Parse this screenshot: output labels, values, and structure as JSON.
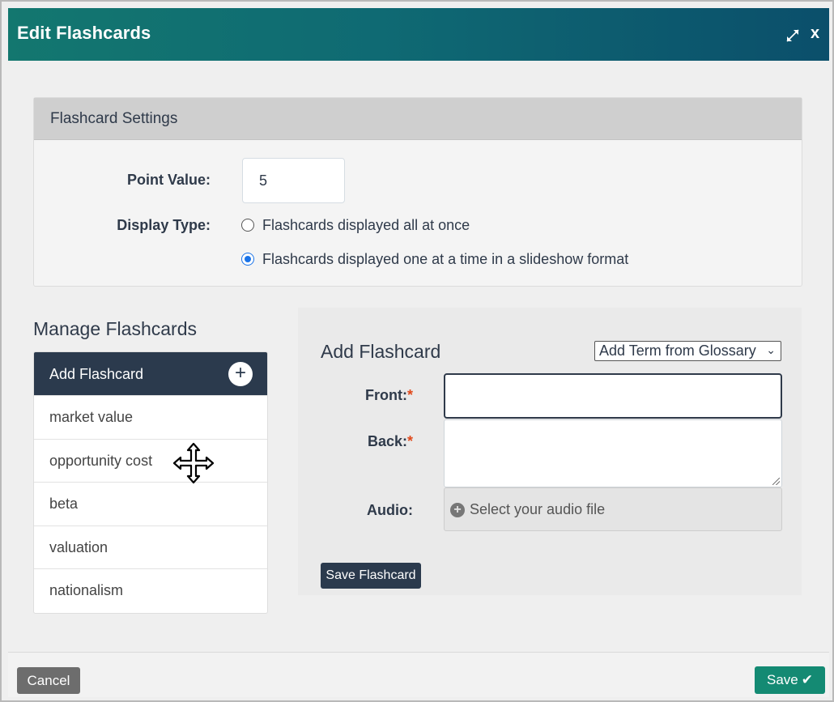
{
  "dialog": {
    "title": "Edit Flashcards",
    "expand_icon": "expand-arrows-icon",
    "close_label": "x"
  },
  "settings": {
    "heading": "Flashcard Settings",
    "point_value_label": "Point Value:",
    "point_value": "5",
    "display_type_label": "Display Type:",
    "display_options": [
      {
        "label": "Flashcards displayed all at once",
        "selected": false
      },
      {
        "label": "Flashcards displayed one at a time in a slideshow format",
        "selected": true
      }
    ]
  },
  "manage": {
    "title": "Manage Flashcards",
    "add_label": "Add Flashcard",
    "add_icon": "+",
    "items": [
      "market value",
      "opportunity cost",
      "beta",
      "valuation",
      "nationalism"
    ]
  },
  "add_form": {
    "title": "Add Flashcard",
    "glossary_select": "Add Term from Glossary",
    "front_label": "Front:",
    "back_label": "Back:",
    "required_mark": "*",
    "audio_label": "Audio:",
    "audio_placeholder": "Select your audio file",
    "audio_icon": "+",
    "save_label": "Save Flashcard"
  },
  "footer": {
    "cancel_label": "Cancel",
    "save_label": "Save",
    "save_icon": "✔"
  },
  "colors": {
    "header_gradient_start": "#13776f",
    "header_gradient_end": "#0b4f6b",
    "dark_navy": "#2b3a4d",
    "save_green": "#148a73",
    "required_red": "#e0491b",
    "radio_blue": "#1a73e8"
  }
}
